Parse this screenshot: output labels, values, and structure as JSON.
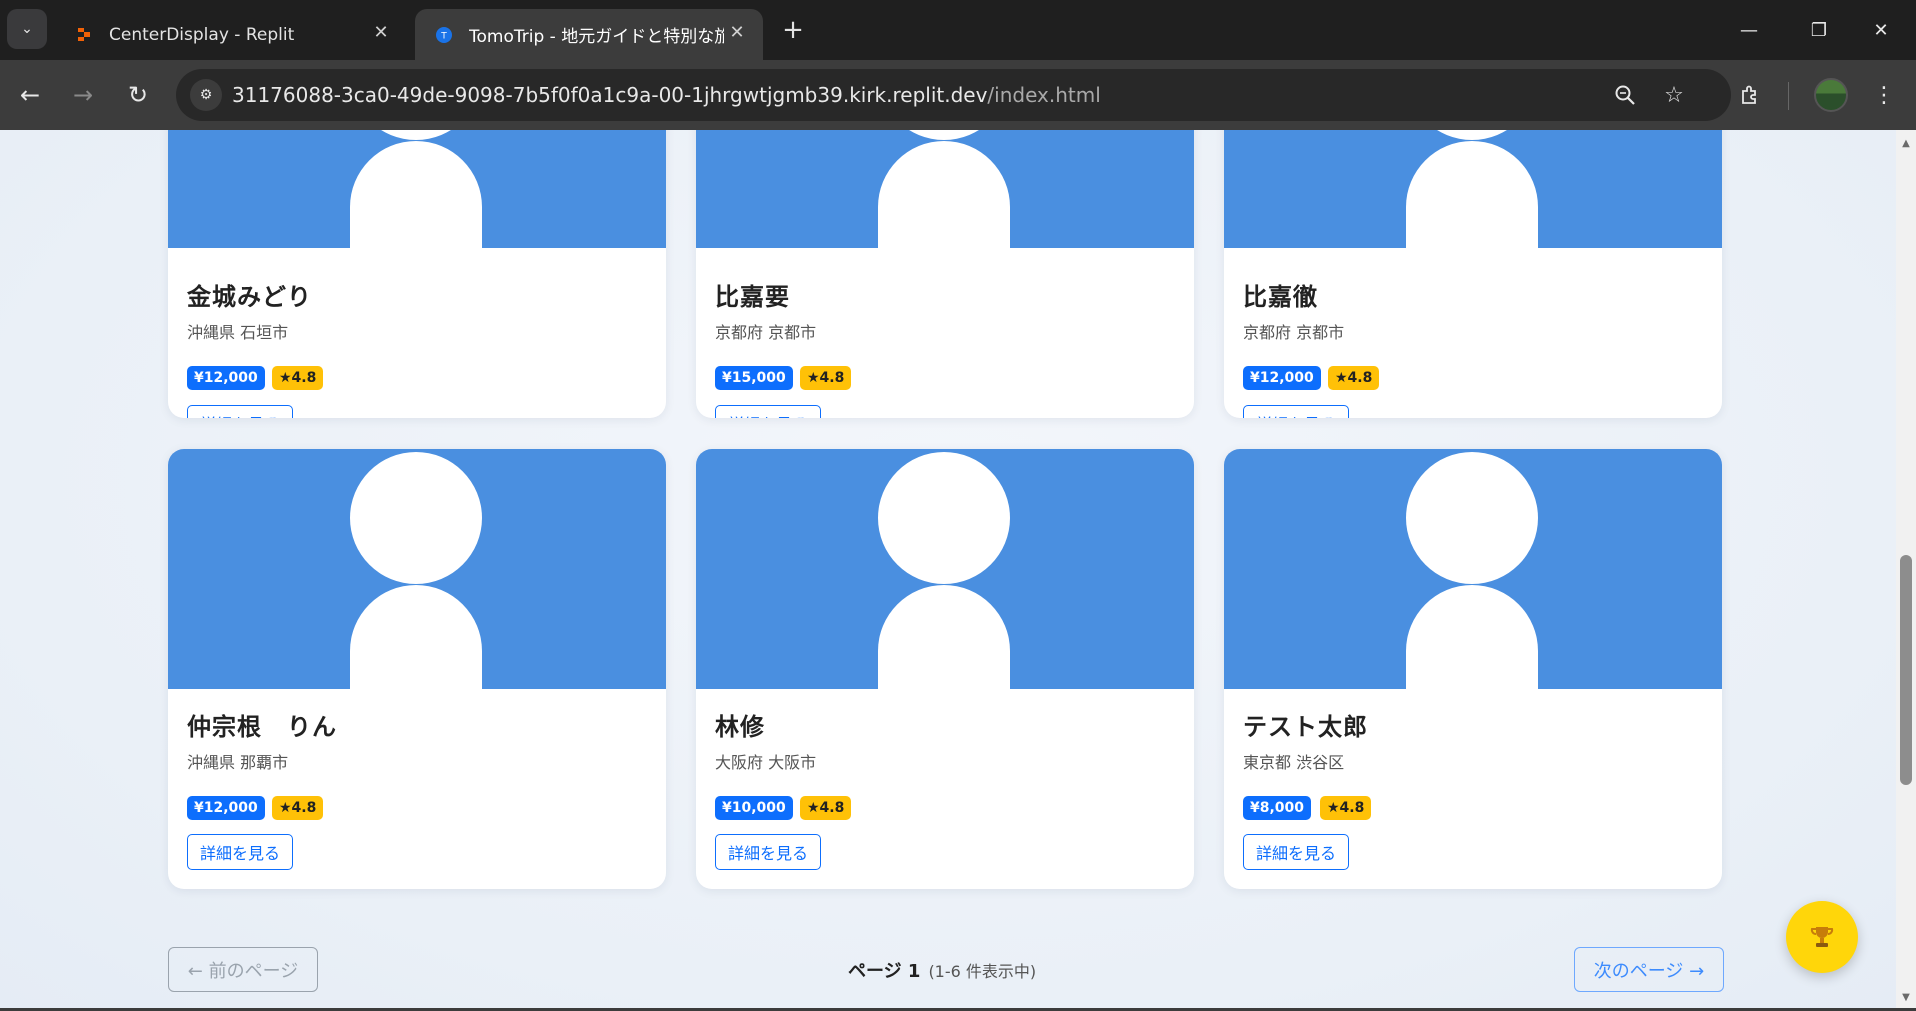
{
  "browser": {
    "tabs": [
      {
        "title": "CenterDisplay - Replit",
        "active": false
      },
      {
        "title": "TomoTrip - 地元ガイドと特別な旅",
        "active": true
      }
    ],
    "url_host": "31176088-3ca0-49de-9098-7b5f0f0a1c9a-00-1jhrgwtjgmb39.kirk.replit.dev",
    "url_path": "/index.html",
    "colors": {
      "chrome_dark": "#1f1f1f",
      "chrome_toolbar": "#3c3c3c",
      "accent": "#0d6efd",
      "rating": "#ffc107",
      "photo_bg": "#4a8fe0"
    }
  },
  "guides": [
    {
      "name": "金城みどり",
      "location": "沖縄県 石垣市",
      "price": "¥12,000",
      "rating": "★4.8",
      "detail_label": "詳細を見る"
    },
    {
      "name": "比嘉要",
      "location": "京都府 京都市",
      "price": "¥15,000",
      "rating": "★4.8",
      "detail_label": "詳細を見る"
    },
    {
      "name": "比嘉徹",
      "location": "京都府 京都市",
      "price": "¥12,000",
      "rating": "★4.8",
      "detail_label": "詳細を見る"
    },
    {
      "name": "仲宗根　りん",
      "location": "沖縄県 那覇市",
      "price": "¥12,000",
      "rating": "★4.8",
      "detail_label": "詳細を見る"
    },
    {
      "name": "林修",
      "location": "大阪府 大阪市",
      "price": "¥10,000",
      "rating": "★4.8",
      "detail_label": "詳細を見る"
    },
    {
      "name": "テスト太郎",
      "location": "東京都 渋谷区",
      "price": "¥8,000",
      "rating": "★4.8",
      "detail_label": "詳細を見る"
    }
  ],
  "pagination": {
    "prev_label": "← 前のページ",
    "next_label": "次のページ →",
    "page_label": "ページ 1",
    "count_label": "(1-6 件表示中)"
  },
  "fab": {
    "icon": "trophy-icon"
  }
}
